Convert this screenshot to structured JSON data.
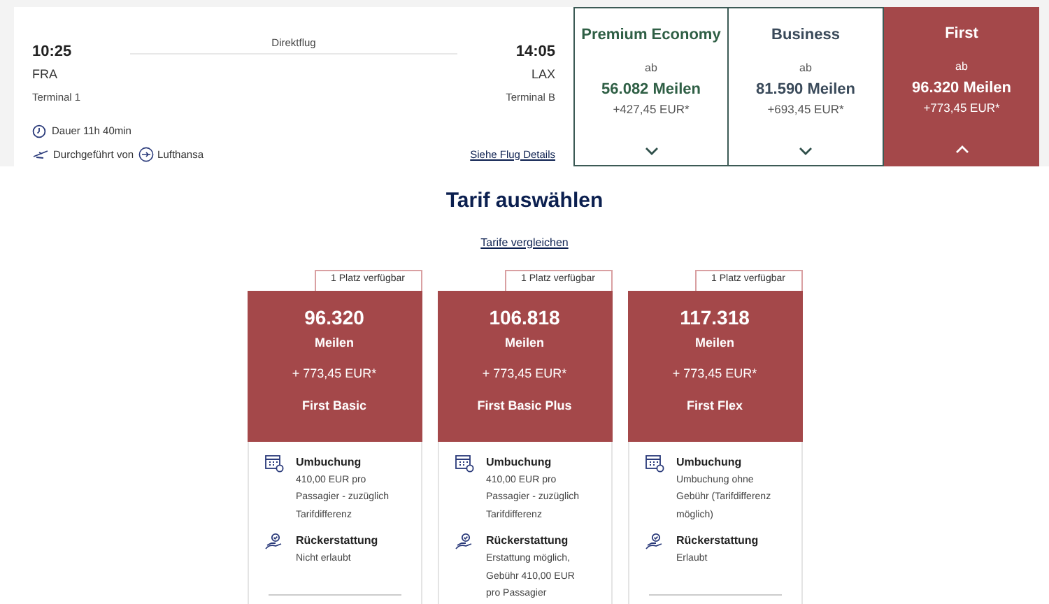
{
  "flight": {
    "type": "Direktflug",
    "departure": {
      "time": "10:25",
      "airport": "FRA",
      "terminal": "Terminal 1"
    },
    "arrival": {
      "time": "14:05",
      "airport": "LAX",
      "terminal": "Terminal B"
    },
    "duration": "Dauer 11h 40min",
    "operated_by": "Durchgeführt von",
    "airline": "Lufthansa",
    "details_link": "Siehe Flug Details"
  },
  "cabins": [
    {
      "name": "Premium Economy",
      "from": "ab",
      "miles": "56.082 Meilen",
      "price": "+427,45 EUR*",
      "selected": false
    },
    {
      "name": "Business",
      "from": "ab",
      "miles": "81.590 Meilen",
      "price": "+693,45 EUR*",
      "selected": false
    },
    {
      "name": "First",
      "from": "ab",
      "miles": "96.320 Meilen",
      "price": "+773,45 EUR*",
      "selected": true
    }
  ],
  "title": "Tarif auswählen",
  "compare_link": "Tarife vergleichen",
  "fares": [
    {
      "badge": "1 Platz verfügbar",
      "miles": "96.320",
      "unit": "Meilen",
      "price": "+ 773,45 EUR*",
      "name": "First Basic",
      "rebooking_label": "Umbuchung",
      "rebooking": "410,00 EUR pro Passagier - zuzüglich Tarifdifferenz",
      "refund_label": "Rückerstattung",
      "refund": "Nicht erlaubt"
    },
    {
      "badge": "1 Platz verfügbar",
      "miles": "106.818",
      "unit": "Meilen",
      "price": "+ 773,45 EUR*",
      "name": "First Basic Plus",
      "rebooking_label": "Umbuchung",
      "rebooking": "410,00 EUR pro Passagier - zuzüglich Tarifdifferenz",
      "refund_label": "Rückerstattung",
      "refund": "Erstattung möglich, Gebühr 410,00 EUR pro Passagier"
    },
    {
      "badge": "1 Platz verfügbar",
      "miles": "117.318",
      "unit": "Meilen",
      "price": "+ 773,45 EUR*",
      "name": "First Flex",
      "rebooking_label": "Umbuchung",
      "rebooking": "Umbuchung ohne Gebühr (Tarifdifferenz möglich)",
      "refund_label": "Rückerstattung",
      "refund": "Erlaubt"
    }
  ]
}
